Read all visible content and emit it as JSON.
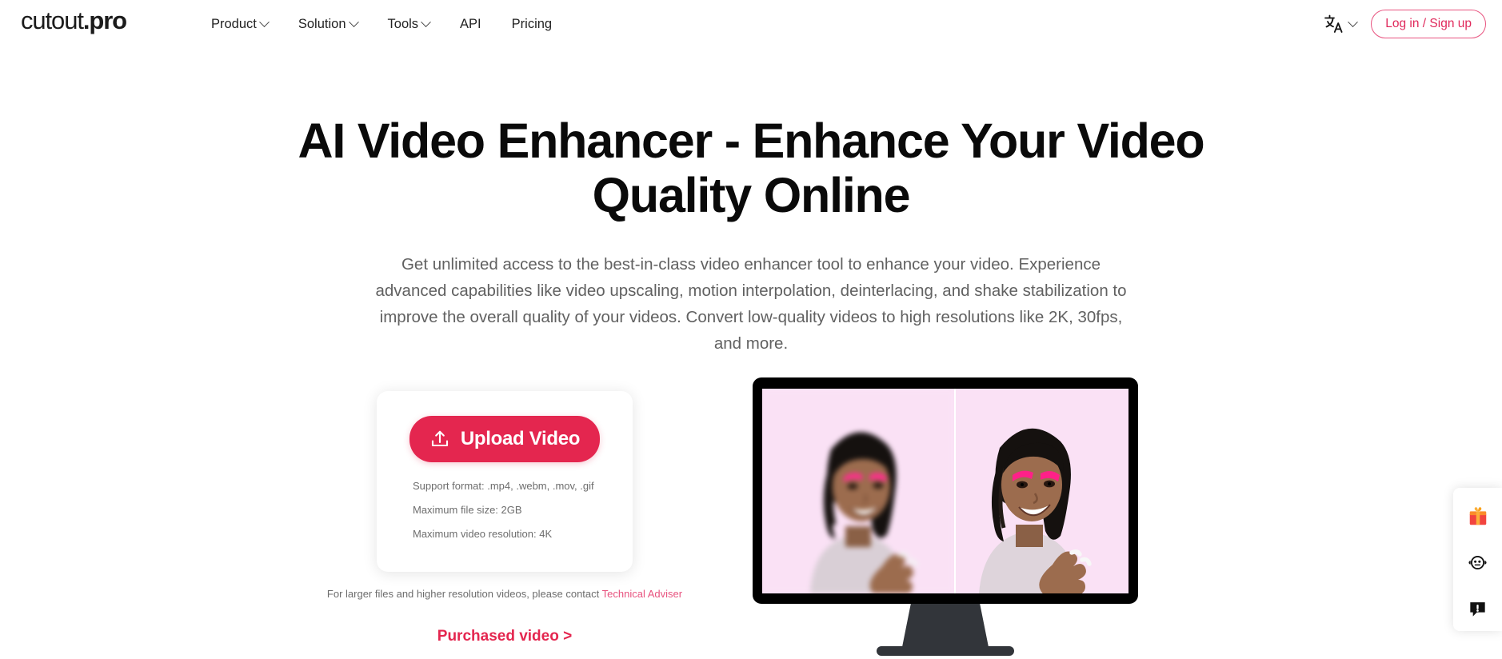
{
  "brand": {
    "logo_text": "cutout",
    "logo_suffix": ".pro",
    "accent_color": "#e4264f",
    "link_color": "#e8537f"
  },
  "header": {
    "nav": [
      {
        "label": "Product",
        "has_dropdown": true,
        "icon": "chevron-down-icon"
      },
      {
        "label": "Solution",
        "has_dropdown": true,
        "icon": "chevron-down-icon"
      },
      {
        "label": "Tools",
        "has_dropdown": true,
        "icon": "chevron-down-icon"
      },
      {
        "label": "API",
        "has_dropdown": false,
        "icon": ""
      },
      {
        "label": "Pricing",
        "has_dropdown": false,
        "icon": ""
      }
    ],
    "language": {
      "icon": "translate-icon",
      "chevron": "chevron-down-icon"
    },
    "login_label": "Log in / Sign up"
  },
  "hero": {
    "title": "AI Video Enhancer - Enhance Your Video Quality Online",
    "subtitle": "Get unlimited access to the best-in-class video enhancer tool to enhance your video. Experience advanced capabilities like video upscaling, motion interpolation, deinterlacing, and shake stabilization to improve the overall quality of your videos. Convert low-quality videos to high resolutions like 2K, 30fps, and more."
  },
  "upload_card": {
    "button_label": "Upload Video",
    "button_icon": "upload-icon",
    "notes": [
      "Support format: .mp4, .webm, .mov, .gif",
      "Maximum file size: 2GB",
      "Maximum video resolution: 4K"
    ]
  },
  "contact": {
    "text": "For larger files and higher resolution videos, please contact ",
    "link_label": "Technical Adviser"
  },
  "purchased_link": "Purchased video >",
  "preview": {
    "alt": "Before and after video enhancement comparison on a monitor",
    "left_panel": "blurry original video",
    "right_panel": "enhanced sharp video"
  },
  "side_widget": {
    "items": [
      {
        "name": "gift-icon",
        "glyph": "gift"
      },
      {
        "name": "customer-service-icon",
        "glyph": "face"
      },
      {
        "name": "feedback-icon",
        "glyph": "chat-alert"
      }
    ]
  }
}
